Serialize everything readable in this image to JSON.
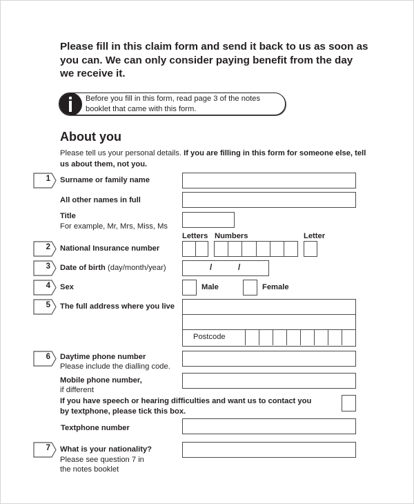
{
  "intro": {
    "heading_lines": [
      "Please fill in this claim form and send it back to us as soon as",
      "you can. We can only consider paying benefit from the day",
      "we receive it."
    ],
    "info_icon": "info-icon",
    "info_lines": [
      "Before you fill in this form, read page 3 of the notes",
      "booklet that came with this form."
    ]
  },
  "section": {
    "title": "About you",
    "intro_plain": "Please tell us your personal details. ",
    "intro_bold_1": "If you are filling in this form for someone else, tell",
    "intro_bold_2": "us about them, not you."
  },
  "questions": {
    "q1": {
      "number": "1",
      "label": "Surname or family name",
      "value": ""
    },
    "other_names": {
      "label": "All other names in full",
      "value": ""
    },
    "title": {
      "label": "Title",
      "hint": "For example, Mr, Mrs, Miss, Ms",
      "value": ""
    },
    "q2": {
      "number": "2",
      "label": "National Insurance number",
      "col_letters": "Letters",
      "col_numbers": "Numbers",
      "col_letter": "Letter"
    },
    "q3": {
      "number": "3",
      "label": "Date of birth",
      "hint": " (day/month/year)",
      "separator": "/"
    },
    "q4": {
      "number": "4",
      "label": "Sex",
      "option_male": "Male",
      "option_female": "Female"
    },
    "q5": {
      "number": "5",
      "label": "The full address where you live",
      "postcode_label": "Postcode"
    },
    "q6": {
      "number": "6",
      "label": "Daytime phone number",
      "hint": "Please include the dialling code.",
      "mobile_label": "Mobile phone number,",
      "mobile_hint": "if different",
      "textphone_tick_line1": "If you have speech or hearing difficulties and want us to contact you",
      "textphone_tick_line2": "by textphone, please tick this box.",
      "textphone_label": "Textphone number"
    },
    "q7": {
      "number": "7",
      "label": "What is your nationality?",
      "hint_line1": "Please see question 7 in",
      "hint_line2": "the notes booklet"
    }
  }
}
